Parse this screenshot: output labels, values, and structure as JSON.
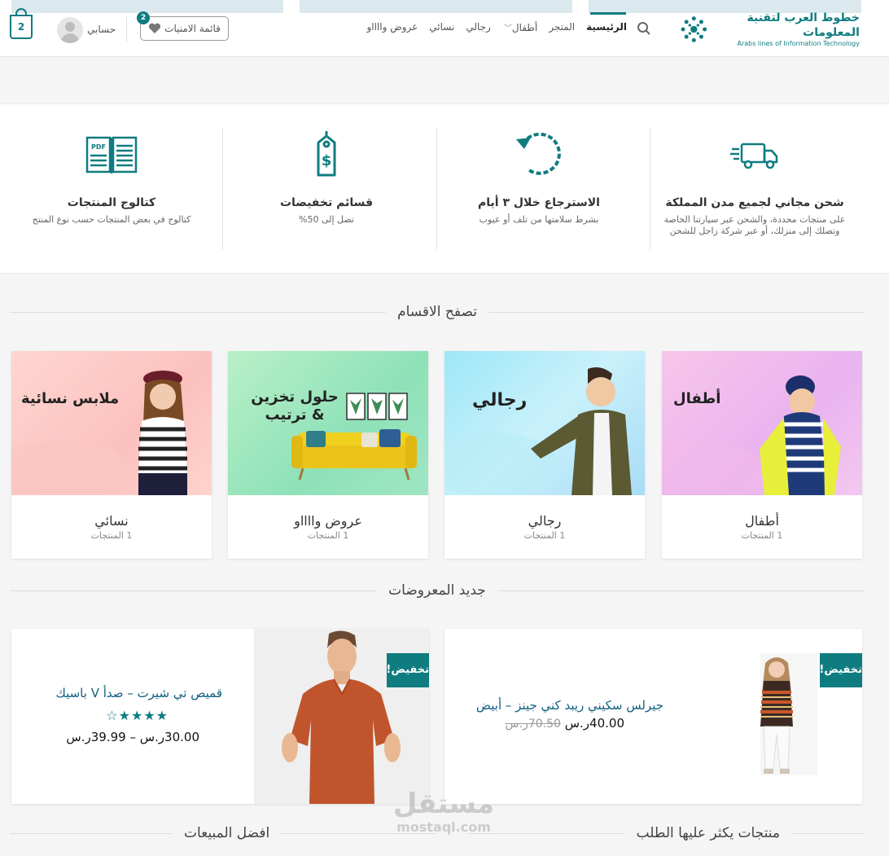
{
  "header": {
    "logo_ar": "خطوط العرب لتقنية المعلومات",
    "logo_en": "Arabs lines of Information Technology",
    "nav": [
      "الرئيسية",
      "المتجر",
      "أطفال",
      "رجالي",
      "نسائي",
      "عروض وااااو"
    ],
    "wishlist_label": "قائمة الامنيات",
    "wishlist_count": "2",
    "account_label": "حسابي",
    "cart_count": "2",
    "accent": "#0f7c80"
  },
  "features": [
    {
      "icon": "truck-icon",
      "title": "شحن مجاني لجميع مدن المملكة",
      "desc": "على منتجات محددة، والشحن عبر سيارتنا الخاصة وتصلك إلى منزلك، أو عبر شركة زاجل للشحن"
    },
    {
      "icon": "refresh-icon",
      "title": "الاسترجاع خلال ٣ أيام",
      "desc": "بشرط سلامتها من تلف أو عيوب"
    },
    {
      "icon": "price-tag-icon",
      "title": "قسائم تخفيضات",
      "desc": "تصل إلى 50%"
    },
    {
      "icon": "pdf-catalog-icon",
      "title": "كتالوج المنتجات",
      "desc": "كتالوج في بعض المنتجات حسب نوع المنتج"
    }
  ],
  "sections": {
    "categories_title": "تصفح الاقسام",
    "new_title": "جديد المعروضات",
    "best_sellers": "افضل المبيعات",
    "most_requested": "منتجات يكثر عليها الطلب"
  },
  "categories": [
    {
      "banner": "أطفال",
      "name": "أطفال",
      "count": "1 المنتجات"
    },
    {
      "banner": "رجالي",
      "name": "رجالي",
      "count": "1 المنتجات"
    },
    {
      "banner": "حلول تخزين & ترتيب",
      "name": "عروض وااااو",
      "count": "1 المنتجات"
    },
    {
      "banner": "ملابس نسائية",
      "name": "نسائي",
      "count": "1 المنتجات"
    }
  ],
  "products": [
    {
      "badge": "تخفيض!",
      "name": "جيرلس سكيني ريبد كني جينز – أبيض",
      "price": "40.00ر.س",
      "old_price": "70.50ر.س"
    },
    {
      "badge": "تخفيض!",
      "name": "قميص تي شيرت – صدأ V باسيك",
      "price_range": "30.00ر.س – 39.99ر.س",
      "rating": 4,
      "rating_max": 5
    }
  ],
  "watermark": {
    "ar": "مستقل",
    "en": "mostaql.com"
  }
}
